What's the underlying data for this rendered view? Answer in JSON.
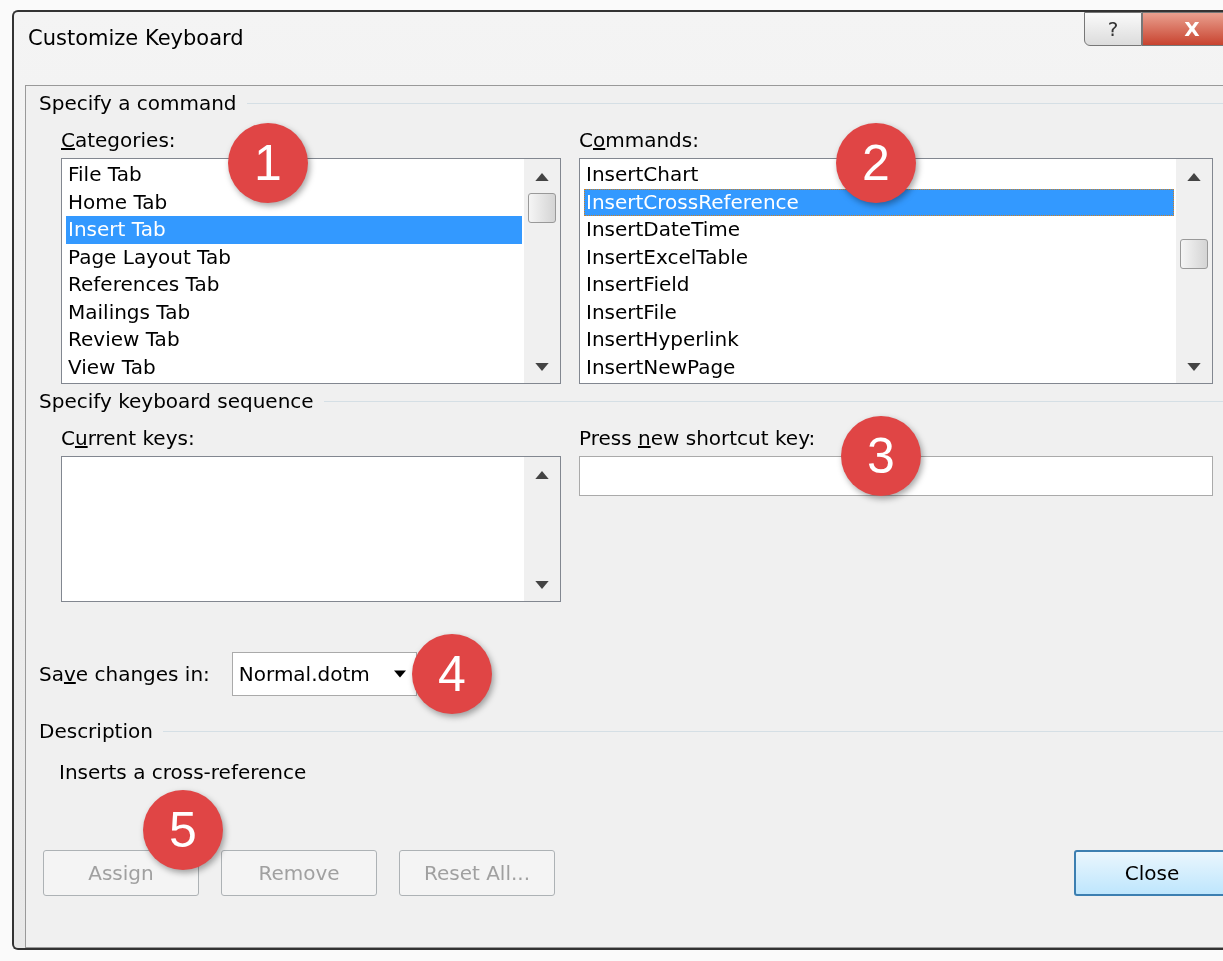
{
  "window": {
    "title": "Customize Keyboard",
    "help_button": "?",
    "close_button": "X"
  },
  "command_section": {
    "title": "Specify a command"
  },
  "categories": {
    "label": {
      "key": "C",
      "after": "ategories:"
    },
    "callout": "1",
    "items": [
      {
        "label": "File Tab",
        "selected": false
      },
      {
        "label": "Home Tab",
        "selected": false
      },
      {
        "label": "Insert Tab",
        "selected": true
      },
      {
        "label": "Page Layout Tab",
        "selected": false
      },
      {
        "label": "References Tab",
        "selected": false
      },
      {
        "label": "Mailings Tab",
        "selected": false
      },
      {
        "label": "Review Tab",
        "selected": false
      },
      {
        "label": "View Tab",
        "selected": false
      }
    ]
  },
  "commands": {
    "label": {
      "before": "C",
      "key": "o",
      "after": "mmands:"
    },
    "callout": "2",
    "items": [
      {
        "label": "InsertChart",
        "selected": false
      },
      {
        "label": "InsertCrossReference",
        "selected": true
      },
      {
        "label": "InsertDateTime",
        "selected": false
      },
      {
        "label": "InsertExcelTable",
        "selected": false
      },
      {
        "label": "InsertField",
        "selected": false
      },
      {
        "label": "InsertFile",
        "selected": false
      },
      {
        "label": "InsertHyperlink",
        "selected": false
      },
      {
        "label": "InsertNewPage",
        "selected": false
      }
    ]
  },
  "keyboard_section": {
    "title": "Specify keyboard sequence"
  },
  "current_keys": {
    "label": {
      "before": "C",
      "key": "u",
      "after": "rrent keys:"
    }
  },
  "new_shortcut": {
    "label": {
      "before": "Press ",
      "key": "n",
      "after": "ew shortcut key:"
    },
    "callout": "3"
  },
  "save_changes": {
    "label": {
      "before": "Sa",
      "key": "v",
      "after": "e changes in:"
    },
    "value": "Normal.dotm",
    "callout": "4"
  },
  "description": {
    "title": "Description",
    "text": "Inserts a cross-reference",
    "callout": "5"
  },
  "buttons": [
    {
      "label": "Assign",
      "disabled": true,
      "default": false
    },
    {
      "label": "Remove",
      "disabled": true,
      "default": false
    },
    {
      "label": "Reset All...",
      "disabled": true,
      "default": false
    },
    {
      "label": "Close",
      "disabled": false,
      "default": true
    }
  ]
}
